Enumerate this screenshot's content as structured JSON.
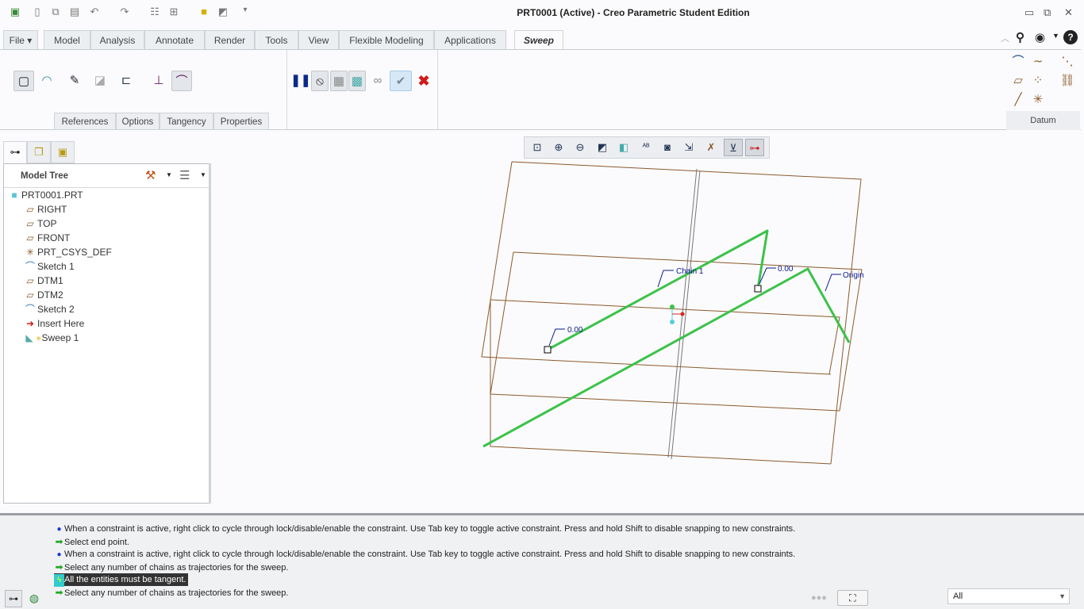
{
  "window": {
    "title": "PRT0001 (Active) - Creo Parametric Student Edition"
  },
  "quick_access": [
    "app-icon",
    "new-icon",
    "open-icon",
    "save-icon",
    "undo-icon",
    "redo-icon",
    "regenerate-icon",
    "windows-icon",
    "close-window-icon",
    "options-icon",
    "customize-icon"
  ],
  "ribbon_tabs": [
    {
      "label": "File ▾"
    },
    {
      "label": "Model"
    },
    {
      "label": "Analysis"
    },
    {
      "label": "Annotate"
    },
    {
      "label": "Render"
    },
    {
      "label": "Tools"
    },
    {
      "label": "View"
    },
    {
      "label": "Flexible Modeling"
    },
    {
      "label": "Applications"
    },
    {
      "label": "Sweep"
    }
  ],
  "active_tab": "Sweep",
  "sweep_subtabs": [
    {
      "label": "References"
    },
    {
      "label": "Options"
    },
    {
      "label": "Tangency"
    },
    {
      "label": "Properties"
    }
  ],
  "datum_group": {
    "label": "Datum"
  },
  "model_tree": {
    "nav_tabs": [
      "model-tree-icon",
      "folder-browser-icon",
      "favorites-icon"
    ],
    "title": "Model Tree",
    "items": [
      {
        "label": "PRT0001.PRT",
        "icon": "part-icon"
      },
      {
        "label": "RIGHT",
        "icon": "datum-plane-icon"
      },
      {
        "label": "TOP",
        "icon": "datum-plane-icon"
      },
      {
        "label": "FRONT",
        "icon": "datum-plane-icon"
      },
      {
        "label": "PRT_CSYS_DEF",
        "icon": "csys-icon"
      },
      {
        "label": "Sketch 1",
        "icon": "sketch-icon"
      },
      {
        "label": "DTM1",
        "icon": "datum-plane-icon"
      },
      {
        "label": "DTM2",
        "icon": "datum-plane-icon"
      },
      {
        "label": "Sketch 2",
        "icon": "sketch-icon"
      },
      {
        "label": "Insert Here",
        "icon": "insert-arrow-icon"
      },
      {
        "label": "Sweep 1",
        "icon": "sweep-icon"
      }
    ]
  },
  "viewport": {
    "labels": {
      "chain": "Chain 1",
      "dim_left": "0.00",
      "dim_right": "0.00",
      "origin": "Origin"
    },
    "colors": {
      "trajectory": "#3cc24a",
      "datum_plane": "#8b5a2b",
      "dimension": "#0a1a8c"
    }
  },
  "messages": [
    {
      "icon": "info-dot-icon",
      "text": "When a constraint is active, right click to cycle through lock/disable/enable the constraint. Use Tab key to toggle active constraint. Press and hold Shift to disable snapping to new constraints."
    },
    {
      "icon": "prompt-arrow-icon",
      "text": "Select end point."
    },
    {
      "icon": "info-dot-icon",
      "text": "When a constraint is active, right click to cycle through lock/disable/enable the constraint. Use Tab key to toggle active constraint. Press and hold Shift to disable snapping to new constraints."
    },
    {
      "icon": "prompt-arrow-icon",
      "text": "Select any number of chains as trajectories for the sweep."
    },
    {
      "icon": "warning-icon",
      "text": "All the entities must be tangent.",
      "highlighted": true
    },
    {
      "icon": "prompt-arrow-icon",
      "text": "Select any number of chains as trajectories for the sweep."
    }
  ],
  "status": {
    "filter_value": "All"
  }
}
